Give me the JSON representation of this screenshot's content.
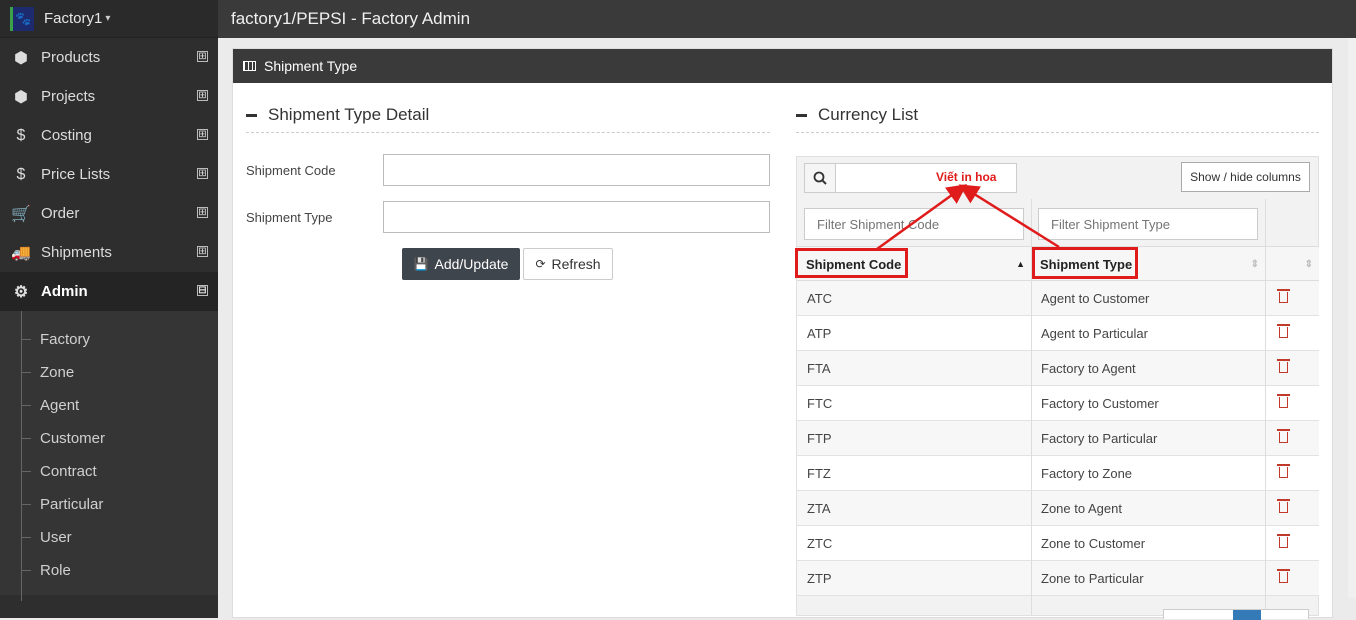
{
  "app": {
    "brand": "Factory1",
    "title": "factory1/PEPSI - Factory Admin"
  },
  "sidebar": {
    "items": [
      {
        "label": "Products",
        "icon": "cube-icon",
        "toggle": "⊞"
      },
      {
        "label": "Projects",
        "icon": "cubes-icon",
        "toggle": "⊞"
      },
      {
        "label": "Costing",
        "icon": "dollar-icon",
        "toggle": "⊞"
      },
      {
        "label": "Price Lists",
        "icon": "dollar-icon",
        "toggle": "⊞"
      },
      {
        "label": "Order",
        "icon": "cart-icon",
        "toggle": "⊞"
      },
      {
        "label": "Shipments",
        "icon": "truck-icon",
        "toggle": "⊞"
      },
      {
        "label": "Admin",
        "icon": "gears-icon",
        "toggle": "⊟"
      }
    ],
    "admin_subitems": [
      "Factory",
      "Zone",
      "Agent",
      "Customer",
      "Contract",
      "Particular",
      "User",
      "Role"
    ]
  },
  "panel": {
    "title": "Shipment Type"
  },
  "detail": {
    "title": "Shipment Type Detail",
    "code_label": "Shipment Code",
    "type_label": "Shipment Type",
    "code_value": "",
    "type_value": "",
    "add_button": "Add/Update",
    "refresh_button": "Refresh"
  },
  "list": {
    "title": "Currency List",
    "search_value": "",
    "show_hide": "Show / hide columns",
    "filter_code_placeholder": "Filter Shipment Code",
    "filter_type_placeholder": "Filter Shipment Type",
    "col_code": "Shipment Code",
    "col_type": "Shipment Type",
    "rows": [
      {
        "code": "ATC",
        "type": "Agent to Customer"
      },
      {
        "code": "ATP",
        "type": "Agent to Particular"
      },
      {
        "code": "FTA",
        "type": "Factory to Agent"
      },
      {
        "code": "FTC",
        "type": "Factory to Customer"
      },
      {
        "code": "FTP",
        "type": "Factory to Particular"
      },
      {
        "code": "FTZ",
        "type": "Factory to Zone"
      },
      {
        "code": "ZTA",
        "type": "Zone to Agent"
      },
      {
        "code": "ZTC",
        "type": "Zone to Customer"
      },
      {
        "code": "ZTP",
        "type": "Zone to Particular"
      }
    ]
  },
  "annotation": {
    "text": "Viết in hoa",
    "color": "#e01b1b"
  }
}
